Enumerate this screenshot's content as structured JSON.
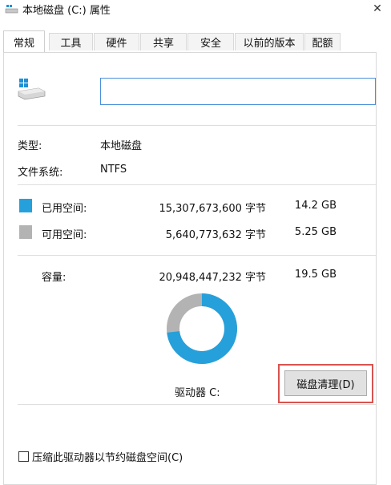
{
  "window": {
    "title": "本地磁盘 (C:) 属性",
    "close_glyph": "✕"
  },
  "tabs": [
    {
      "label": "常规",
      "active": true
    },
    {
      "label": "工具",
      "active": false
    },
    {
      "label": "硬件",
      "active": false
    },
    {
      "label": "共享",
      "active": false
    },
    {
      "label": "安全",
      "active": false
    },
    {
      "label": "以前的版本",
      "active": false
    },
    {
      "label": "配额",
      "active": false
    }
  ],
  "drive": {
    "icon": "drive-icon",
    "name_value": ""
  },
  "info": {
    "type_label": "类型:",
    "type_value": "本地磁盘",
    "fs_label": "文件系统:",
    "fs_value": "NTFS"
  },
  "space": {
    "used_label": "已用空间:",
    "used_bytes": "15,307,673,600 字节",
    "used_size": "14.2 GB",
    "used_color": "#26a0da",
    "free_label": "可用空间:",
    "free_bytes": "5,640,773,632 字节",
    "free_size": "5.25 GB",
    "free_color": "#b3b3b3",
    "capacity_label": "容量:",
    "capacity_bytes": "20,948,447,232 字节",
    "capacity_size": "19.5 GB",
    "used_fraction": 0.7307
  },
  "drive_label": "驱动器 C:",
  "cleanup_button": "磁盘清理(D)",
  "compress_label": "压缩此驱动器以节约磁盘空间(C)"
}
